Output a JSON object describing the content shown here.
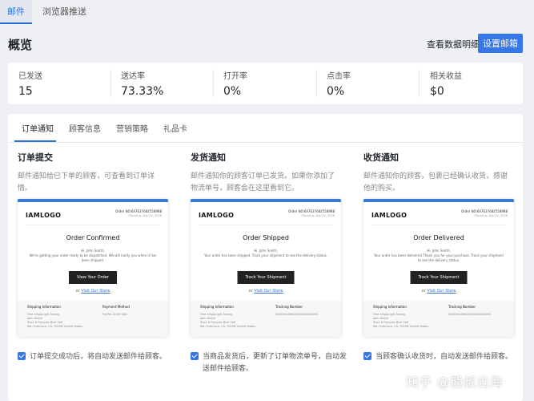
{
  "topnav": {
    "tabs": [
      {
        "label": "邮件"
      },
      {
        "label": "浏览器推送"
      }
    ]
  },
  "header": {
    "title": "概览",
    "detail_link": "查看数据明细",
    "setup_button": "设置邮箱"
  },
  "stats": [
    {
      "label": "已发送",
      "value": "15"
    },
    {
      "label": "送达率",
      "value": "73.33%"
    },
    {
      "label": "打开率",
      "value": "0%"
    },
    {
      "label": "点击率",
      "value": "0%"
    },
    {
      "label": "相关收益",
      "value": "$0"
    }
  ],
  "subtabs": [
    {
      "label": "订单通知"
    },
    {
      "label": "顾客信息"
    },
    {
      "label": "营销策略"
    },
    {
      "label": "礼品卡"
    }
  ],
  "cards": [
    {
      "title": "订单提交",
      "desc": "邮件通知给已下单的顾客，可查看到订单详情。",
      "preview": {
        "logo": "IAMLOGO",
        "order_no": "Order NO.647637682558988",
        "order_date": "Placed on Sep 25, 2020",
        "heading": "Order Confirmed",
        "greeting": "Hi, John Smith,",
        "message": "We're getting your order ready to be dispatched. We will notify you when it has been shipped.",
        "button": "View Your Order",
        "visit_prefix": "or",
        "visit_link": "Visit Our Store",
        "left_head": "Shipping Information",
        "left_lines": [
          "Free Shipping(3-5days)",
          "John Smith",
          "Terry A Francois Blvd 500",
          "San Francisco, CA, 94158 United States"
        ],
        "right_head": "Payment Method",
        "right_lines": [
          "PayPal 20.00 USD"
        ]
      },
      "checkbox_label": "订单提交成功后，将自动发送邮件给顾客。"
    },
    {
      "title": "发货通知",
      "desc": "邮件通知你的顾客订单已发货。如果你添加了物流单号，顾客会在这里看到它。",
      "preview": {
        "logo": "IAMLOGO",
        "order_no": "Order NO.647637682558988",
        "order_date": "Placed on Sep 25, 2020",
        "heading": "Order Shipped",
        "greeting": "Hi, John Smith,",
        "message": "Your order has been shipped. Track your shipment to see the delivery status.",
        "button": "Track Your Shipment",
        "visit_prefix": "or",
        "visit_link": "Visit Our Store",
        "left_head": "Shipping Information",
        "left_lines": [
          "Free Shipping(3-5days)",
          "John Smith",
          "Terry A Francois Blvd 500",
          "San Francisco, CA, 94158 United States"
        ],
        "right_head": "Tracking Number",
        "right_lines": [
          "940000000000000000000000"
        ]
      },
      "checkbox_label": "当商品发货后，更新了订单物流单号，自动发送邮件给顾客。"
    },
    {
      "title": "收货通知",
      "desc": "邮件通知你的顾客，包裹已经确认收货，感谢他的购买。",
      "preview": {
        "logo": "IAMLOGO",
        "order_no": "Order NO.647637682558988",
        "order_date": "Placed on Sep 25, 2020",
        "heading": "Order Delivered",
        "greeting": "Hi, John Smith,",
        "message": "Your order has been delivered.Thank you for your purchase. Track your shipment to see the delivery status.",
        "button": "Track Your Shipment",
        "visit_prefix": "or",
        "visit_link": "Visit Our Store",
        "left_head": "Shipping Information",
        "left_lines": [
          "Free Shipping(3-5days)",
          "John Smith",
          "Terry A Francois Blvd 500",
          "San Francisco, CA, 94158 United States"
        ],
        "right_head": "Tracking Number",
        "right_lines": [
          "940000000000000000000000"
        ]
      },
      "checkbox_label": "当顾客确认收货时，自动发送邮件给顾客。"
    }
  ],
  "watermark": "知乎 @熊叔出海"
}
